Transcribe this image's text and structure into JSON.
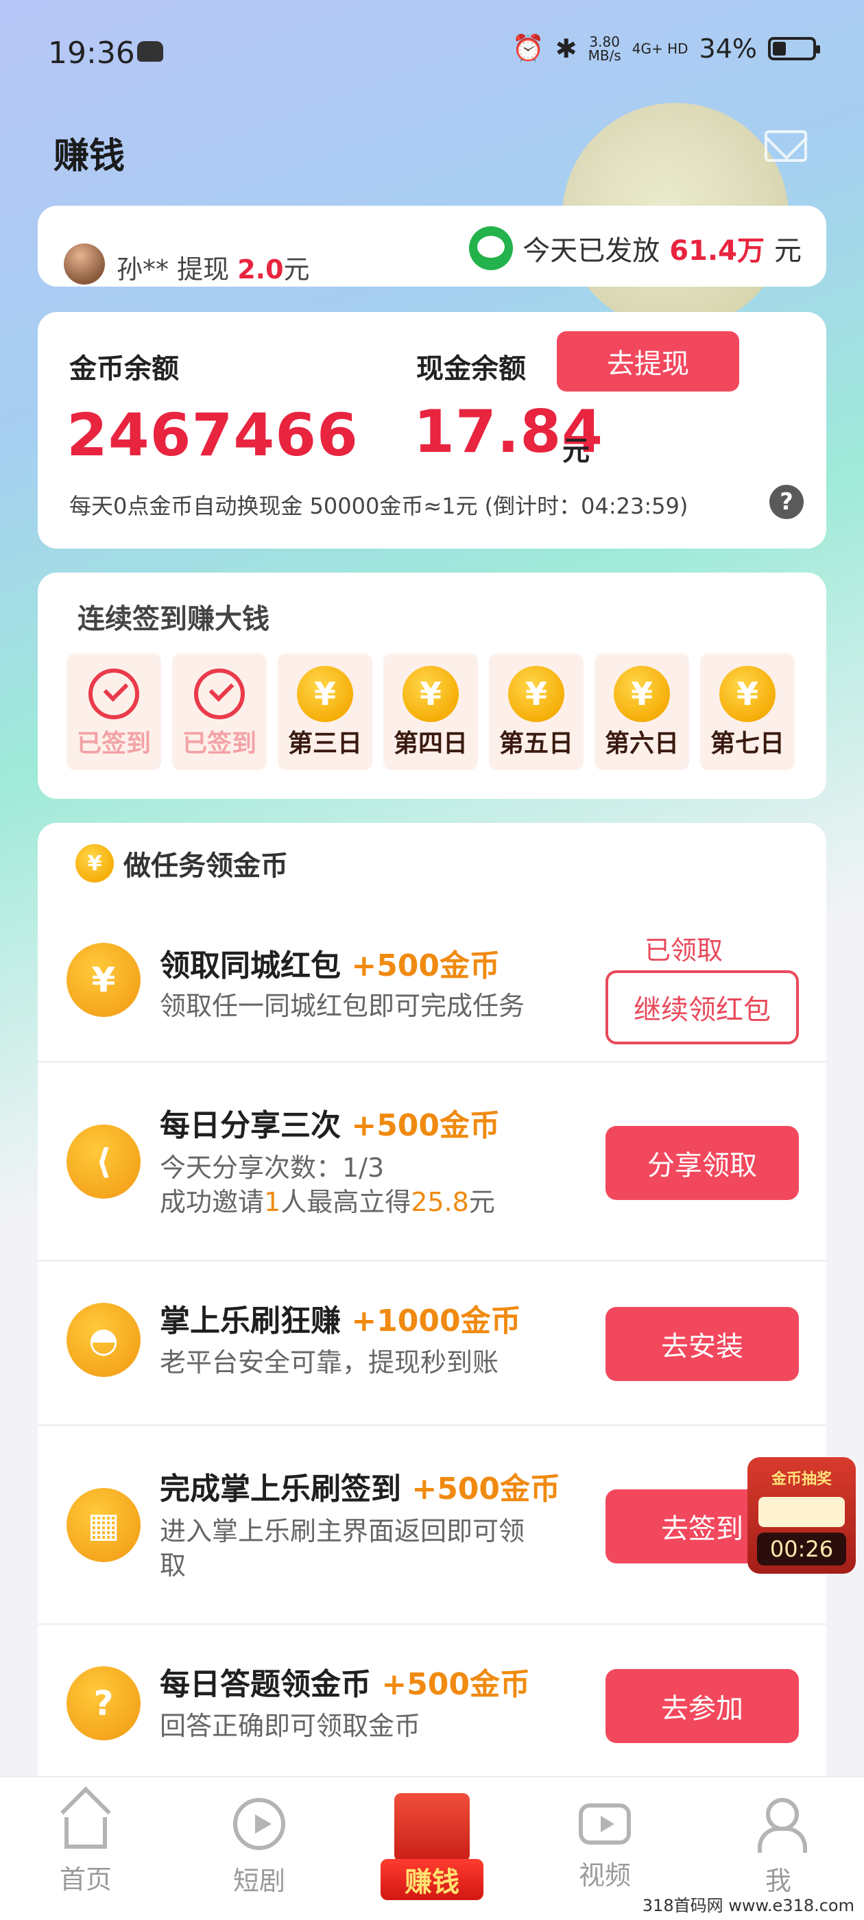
{
  "status_bar": {
    "time": "19:36",
    "speed": "3.80",
    "speed_unit": "MB/s",
    "network": "4G+ HD",
    "battery": "34%",
    "battery_level": 0.34
  },
  "page": {
    "title": "赚钱"
  },
  "notice": {
    "user": "孙**",
    "action": "提现",
    "amount": "2.0",
    "unit": "元",
    "today_prefix": "今天已发放",
    "today_amount": "61.4万",
    "today_unit": "元"
  },
  "balance": {
    "coin_label": "金币余额",
    "coin_value": "2467466",
    "cash_label": "现金余额",
    "cash_value": "17.84",
    "cash_unit": "元",
    "withdraw_label": "去提现",
    "note": "每天0点金币自动换现金 50000金币≈1元 (倒计时：04:23:59)",
    "help": "?"
  },
  "checkin": {
    "title": "连续签到赚大钱",
    "days": [
      {
        "label": "已签到",
        "done": true
      },
      {
        "label": "已签到",
        "done": true
      },
      {
        "label": "第三日",
        "done": false
      },
      {
        "label": "第四日",
        "done": false
      },
      {
        "label": "第五日",
        "done": false
      },
      {
        "label": "第六日",
        "done": false
      },
      {
        "label": "第七日",
        "done": false
      }
    ],
    "coin_symbol": "¥"
  },
  "tasks": {
    "title": "做任务领金币",
    "coin_symbol": "¥",
    "items": [
      {
        "title": "领取同城红包",
        "reward": "+500金币",
        "desc": "领取任一同城红包即可完成任务",
        "status": "已领取",
        "button": "继续领红包"
      },
      {
        "title": "每日分享三次",
        "reward": "+500金币",
        "desc1": "今天分享次数：1/3",
        "desc2_a": "成功邀请",
        "desc2_b": "1",
        "desc2_c": "人最高立得",
        "desc2_d": "25.8",
        "desc2_e": "元",
        "button": "分享领取"
      },
      {
        "title": "掌上乐刷狂赚",
        "reward": "+1000金币",
        "desc": "老平台安全可靠，提现秒到账",
        "button": "去安装"
      },
      {
        "title": "完成掌上乐刷签到",
        "reward": "+500金币",
        "desc1": "进入掌上乐刷主界面返回即可领",
        "desc2": "取",
        "button": "去签到"
      },
      {
        "title": "每日答题领金币",
        "reward": "+500金币",
        "desc": "回答正确即可领取金币",
        "button": "去参加"
      }
    ]
  },
  "float_widget": {
    "label": "金币抽奖",
    "timer": "00:26"
  },
  "bottom_nav": {
    "items": [
      "首页",
      "短剧",
      "赚钱",
      "视频",
      "我"
    ]
  },
  "watermark": "318首码网   www.e318.com"
}
